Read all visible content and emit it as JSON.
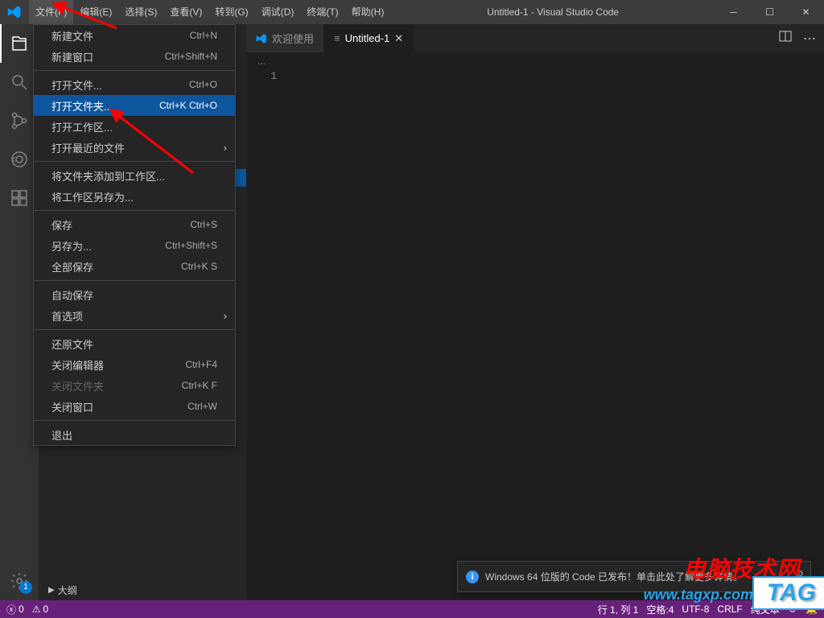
{
  "window": {
    "title": "Untitled-1 - Visual Studio Code"
  },
  "menubar": {
    "items": [
      "文件(F)",
      "编辑(E)",
      "选择(S)",
      "查看(V)",
      "转到(G)",
      "调试(D)",
      "终端(T)",
      "帮助(H)"
    ]
  },
  "file_menu": {
    "groups": [
      [
        {
          "label": "新建文件",
          "kb": "Ctrl+N"
        },
        {
          "label": "新建窗口",
          "kb": "Ctrl+Shift+N"
        }
      ],
      [
        {
          "label": "打开文件...",
          "kb": "Ctrl+O"
        },
        {
          "label": "打开文件夹...",
          "kb": "Ctrl+K Ctrl+O",
          "highlight": true
        },
        {
          "label": "打开工作区..."
        },
        {
          "label": "打开最近的文件",
          "submenu": true
        }
      ],
      [
        {
          "label": "将文件夹添加到工作区..."
        },
        {
          "label": "将工作区另存为..."
        }
      ],
      [
        {
          "label": "保存",
          "kb": "Ctrl+S"
        },
        {
          "label": "另存为...",
          "kb": "Ctrl+Shift+S"
        },
        {
          "label": "全部保存",
          "kb": "Ctrl+K S"
        }
      ],
      [
        {
          "label": "自动保存"
        },
        {
          "label": "首选项",
          "submenu": true
        }
      ],
      [
        {
          "label": "还原文件"
        },
        {
          "label": "关闭编辑器",
          "kb": "Ctrl+F4"
        },
        {
          "label": "关闭文件夹",
          "kb": "Ctrl+K F",
          "disabled": true
        },
        {
          "label": "关闭窗口",
          "kb": "Ctrl+W"
        }
      ],
      [
        {
          "label": "退出"
        }
      ]
    ]
  },
  "tabs": {
    "items": [
      {
        "label": "欢迎使用",
        "icon": "vscode"
      },
      {
        "label": "Untitled-1",
        "icon": "file",
        "active": true,
        "close": true
      }
    ]
  },
  "breadcrumb": "...",
  "gutter_line": "1",
  "activity_badge": "1",
  "sidebar": {
    "outline": "大纲"
  },
  "notification": "Windows 64 位版的 Code 已发布！单击此处了解更多详情。",
  "status": {
    "errors": "0",
    "warnings": "0",
    "ln_col": "行 1, 列 1",
    "spaces": "空格:4",
    "encoding": "UTF-8",
    "eol": "CRLF",
    "lang": "纯文本",
    "feedback": "☺",
    "bell": "🔔"
  },
  "watermark": {
    "red": "电脑技术网",
    "blue": "www.tagxp.com",
    "tag": "TAG"
  }
}
